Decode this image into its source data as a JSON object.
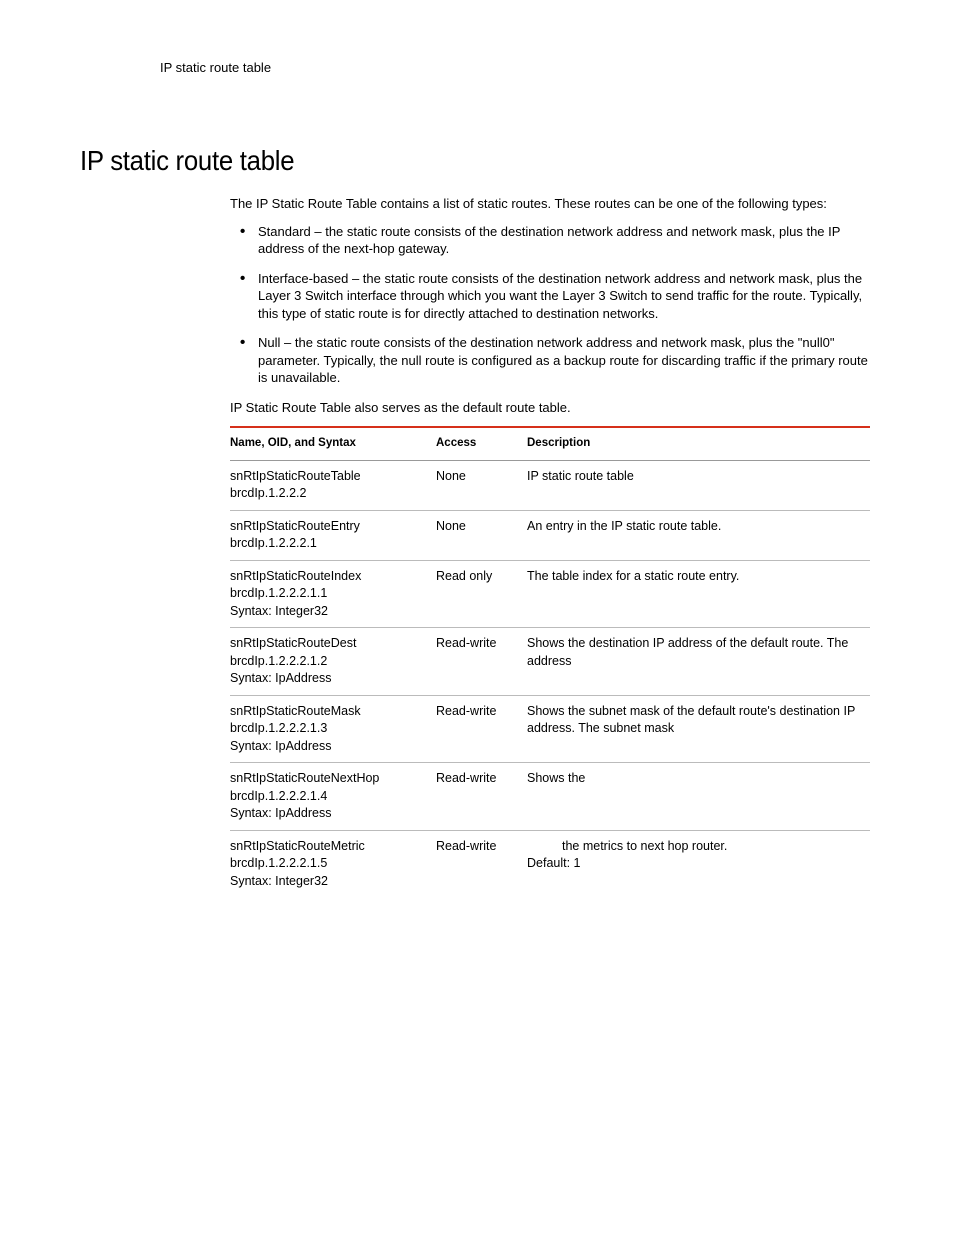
{
  "running_head": "IP static route table",
  "heading": "IP static route table",
  "intro": "The IP Static Route Table contains a list of static routes. These routes can be one of the following types:",
  "bullets": [
    "Standard – the static route consists of the destination network address and network mask, plus the IP address of the next-hop gateway.",
    "Interface-based – the static route consists of the destination network address and network mask, plus the Layer 3 Switch interface through which you want the Layer 3 Switch to send traffic for the route. Typically, this type of static route is for directly attached to destination networks.",
    "Null – the static route consists of the destination network address and network mask, plus the \"null0\" parameter. Typically, the null route is configured as a backup route for discarding traffic if the primary route is unavailable."
  ],
  "outro": "IP Static Route Table also serves as the default route table.",
  "table": {
    "headers": [
      "Name, OID, and Syntax",
      "Access",
      "Description"
    ],
    "rows": [
      {
        "name": "snRtIpStaticRouteTable\nbrcdIp.1.2.2.2",
        "access": "None",
        "desc": "IP static route table"
      },
      {
        "name": "snRtIpStaticRouteEntry\nbrcdIp.1.2.2.2.1",
        "access": "None",
        "desc": "An entry in the IP static route table."
      },
      {
        "name": "snRtIpStaticRouteIndex\nbrcdIp.1.2.2.2.1.1\nSyntax: Integer32",
        "access": "Read only",
        "desc": "The table index for a static route entry."
      },
      {
        "name": "snRtIpStaticRouteDest\nbrcdIp.1.2.2.2.1.2\nSyntax: IpAddress",
        "access": "Read-write",
        "desc": "Shows the destination IP address of the default route. The address"
      },
      {
        "name": "snRtIpStaticRouteMask\nbrcdIp.1.2.2.2.1.3\nSyntax: IpAddress",
        "access": "Read-write",
        "desc": "Shows the subnet mask of the default route's destination IP address. The subnet mask"
      },
      {
        "name": "snRtIpStaticRouteNextHop\nbrcdIp.1.2.2.2.1.4\nSyntax: IpAddress",
        "access": "Read-write",
        "desc": "Shows the"
      },
      {
        "name": "snRtIpStaticRouteMetric\nbrcdIp.1.2.2.2.1.5\nSyntax: Integer32",
        "access": "Read-write",
        "desc_line1": " the metrics to next hop router.",
        "desc_line2": "Default: 1"
      }
    ]
  }
}
